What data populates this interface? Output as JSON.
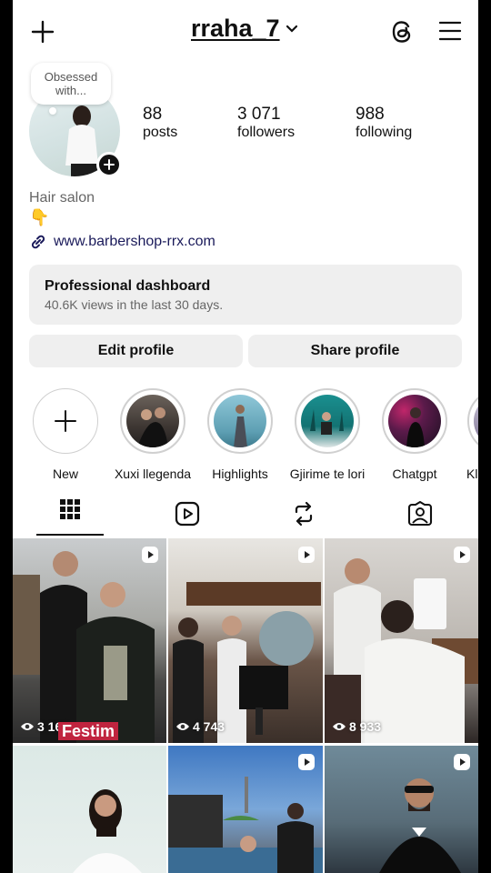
{
  "header": {
    "username": "rraha_7"
  },
  "note": {
    "text": "Obsessed with..."
  },
  "stats": [
    {
      "value": "88",
      "label": "posts"
    },
    {
      "value": "3 071",
      "label": "followers"
    },
    {
      "value": "988",
      "label": "following"
    }
  ],
  "bio": {
    "category": "Hair salon",
    "emoji": "👇",
    "link": "www.barbershop-rrx.com"
  },
  "dashboard": {
    "title": "Professional dashboard",
    "subtitle": "40.6K views in the last 30 days."
  },
  "buttons": {
    "edit": "Edit profile",
    "share": "Share profile"
  },
  "highlights": [
    "New",
    "Xuxi llegenda",
    "Highlights",
    "Gjirime te lori",
    "Chatgpt",
    "Kla"
  ],
  "tabs": [
    "grid",
    "reels",
    "reposts",
    "tagged"
  ],
  "grid": {
    "posts": [
      {
        "views": "3 168",
        "caption": "Festim"
      },
      {
        "views": "4 743"
      },
      {
        "views": "8 933"
      }
    ]
  },
  "colors": {
    "text": "#111111",
    "muted": "#666666",
    "button_bg": "#efefef",
    "link": "#1a1a5a"
  }
}
